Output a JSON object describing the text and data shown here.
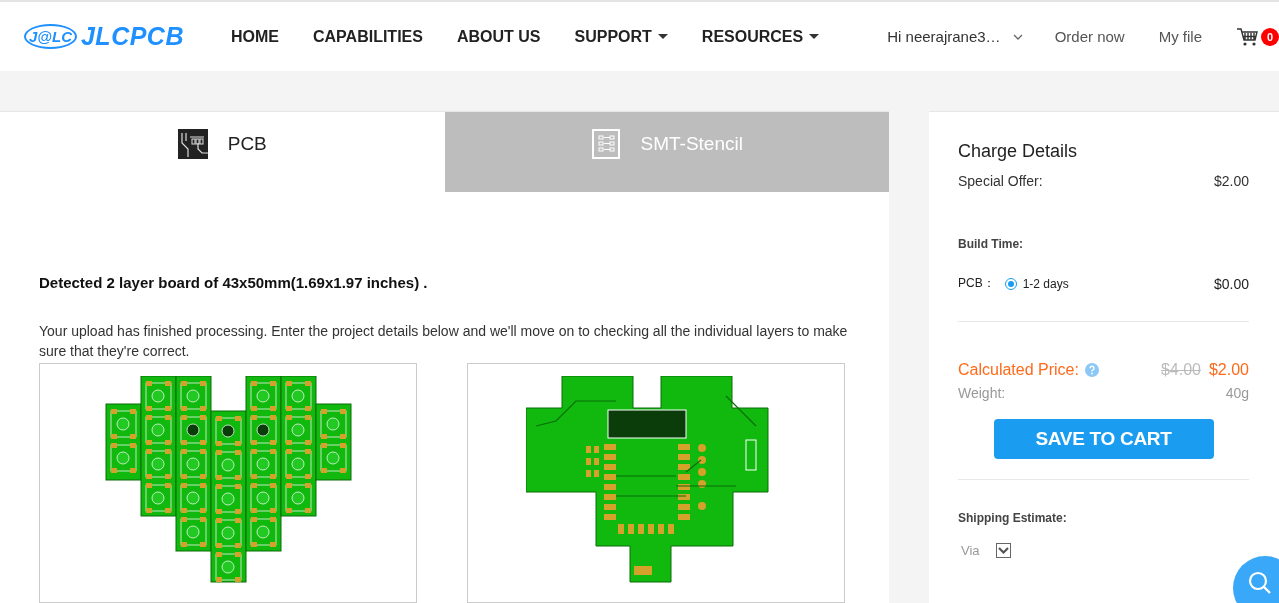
{
  "header": {
    "logo_badge": "J@LC",
    "logo_text": "JLCPCB",
    "nav": [
      {
        "label": "HOME",
        "dropdown": false
      },
      {
        "label": "CAPABILITIES",
        "dropdown": false
      },
      {
        "label": "ABOUT US",
        "dropdown": false
      },
      {
        "label": "SUPPORT",
        "dropdown": true
      },
      {
        "label": "RESOURCES",
        "dropdown": true
      }
    ],
    "user": "Hi neerajrane3…",
    "links": [
      "Order now",
      "My file"
    ],
    "cart_count": "0"
  },
  "tabs": [
    {
      "label": "PCB",
      "selected": true,
      "kind": "pcb"
    },
    {
      "label": "SMT-Stencil",
      "selected": false,
      "kind": "stencil"
    }
  ],
  "detected": "Detected 2 layer board of 43x50mm(1.69x1.97 inches) .",
  "message": "Your upload has finished processing. Enter the project details below and we'll move on to checking all the individual layers to make sure that they're correct.",
  "previews": [
    {
      "kind": "top"
    },
    {
      "kind": "bottom"
    }
  ],
  "charge": {
    "title": "Charge Details",
    "special_offer": {
      "label": "Special Offer:",
      "value": "$2.00"
    },
    "build_time": {
      "heading": "Build Time:",
      "label": "PCB：",
      "options": [
        {
          "label": "1-2 days",
          "selected": true
        }
      ],
      "price": "$0.00"
    },
    "calculated": {
      "label": "Calculated Price:",
      "old": "$4.00",
      "new": "$2.00"
    },
    "weight": {
      "label": "Weight:",
      "value": "40g"
    },
    "save_button": "SAVE TO CART",
    "shipping": {
      "heading": "Shipping Estimate:",
      "via": "Via"
    }
  }
}
